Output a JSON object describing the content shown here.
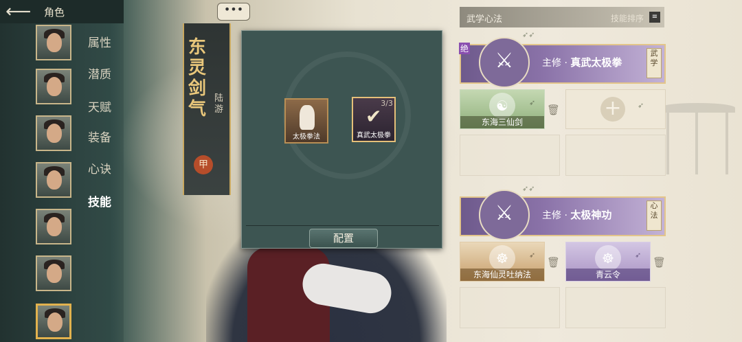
{
  "header": {
    "back_icon": "arrow-left-icon",
    "title": "角色"
  },
  "nav": [
    {
      "label": "属性",
      "active": false
    },
    {
      "label": "潜质",
      "active": false
    },
    {
      "label": "天赋",
      "active": false
    },
    {
      "label": "装备",
      "active": false
    },
    {
      "label": "心诀",
      "active": false
    },
    {
      "label": "技能",
      "active": true
    }
  ],
  "character": {
    "name": "东灵剑气",
    "sub": "陆游",
    "seal": "甲",
    "more": "•••"
  },
  "popup": {
    "slots": [
      {
        "label": "太极拳法",
        "count": ""
      },
      {
        "label": "真武太极拳",
        "count": "3/3"
      }
    ],
    "config_label": "配置"
  },
  "right_panel": {
    "title": "武学心法",
    "sort_label": "技能排序",
    "sections": [
      {
        "main_prefix": "主修 · ",
        "main_name": "真武太极拳",
        "tag": "武学",
        "corner": "绝",
        "subs": [
          {
            "label": "东海三仙剑",
            "style": "green"
          }
        ]
      },
      {
        "main_prefix": "主修 · ",
        "main_name": "太极神功",
        "tag": "心法",
        "corner": "",
        "subs": [
          {
            "label": "东海仙灵吐纳法",
            "style": "orange"
          },
          {
            "label": "青云令",
            "style": "purple"
          }
        ]
      }
    ]
  },
  "colors": {
    "accent_gold": "#e3c58a",
    "purple_main": "#8a72a8",
    "sidebar": "#2f4643"
  }
}
